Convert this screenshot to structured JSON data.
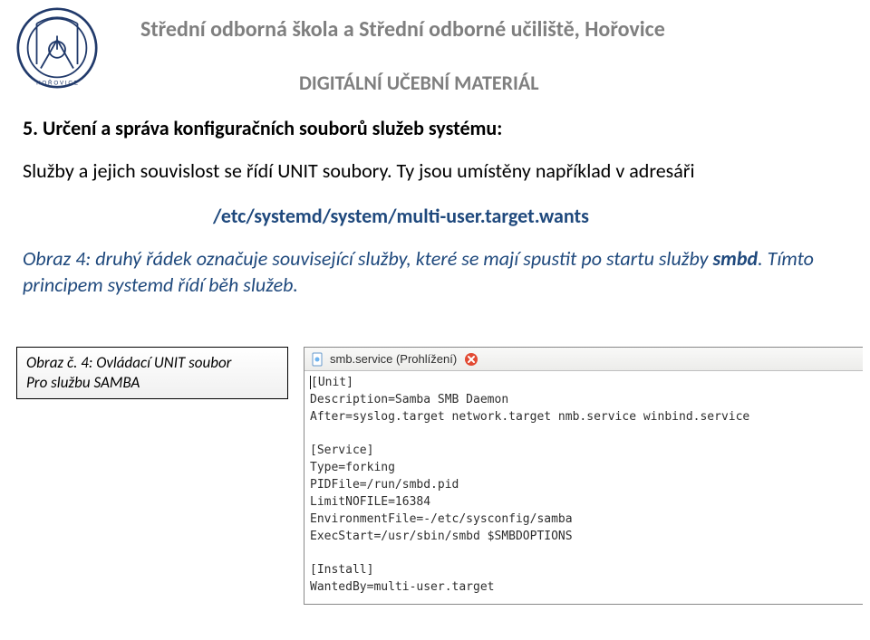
{
  "header": {
    "school": "Střední odborná škola a Střední odborné učiliště, Hořovice",
    "subtitle": "DIGITÁLNÍ UČEBNÍ MATERIÁL"
  },
  "section": {
    "heading": "5. Určení a správa konfiguračních souborů služeb systému:",
    "para1": "Služby a jejich souvislost se řídí UNIT soubory. Ty jsou umístěny například v adresáři",
    "path": "/etc/systemd/system/multi-user.target.wants",
    "para2_prefix": "Obraz 4: druhý řádek označuje související služby, které se mají spustit po startu služby ",
    "para2_bold": "smbd",
    "para2_suffix": ". Tímto principem systemd řídí běh služeb."
  },
  "caption": {
    "line1": "Obraz č. 4: Ovládací UNIT soubor",
    "line2": "Pro službu SAMBA"
  },
  "editor": {
    "title": "smb.service (Prohlížení)",
    "lines": {
      "l1": "[Unit]",
      "l2": "Description=Samba SMB Daemon",
      "l3": "After=syslog.target network.target nmb.service winbind.service",
      "l4": "",
      "l5": "[Service]",
      "l6": "Type=forking",
      "l7": "PIDFile=/run/smbd.pid",
      "l8": "LimitNOFILE=16384",
      "l9": "EnvironmentFile=-/etc/sysconfig/samba",
      "l10": "ExecStart=/usr/sbin/smbd $SMBDOPTIONS",
      "l11": "",
      "l12": "[Install]",
      "l13": "WantedBy=multi-user.target"
    }
  }
}
